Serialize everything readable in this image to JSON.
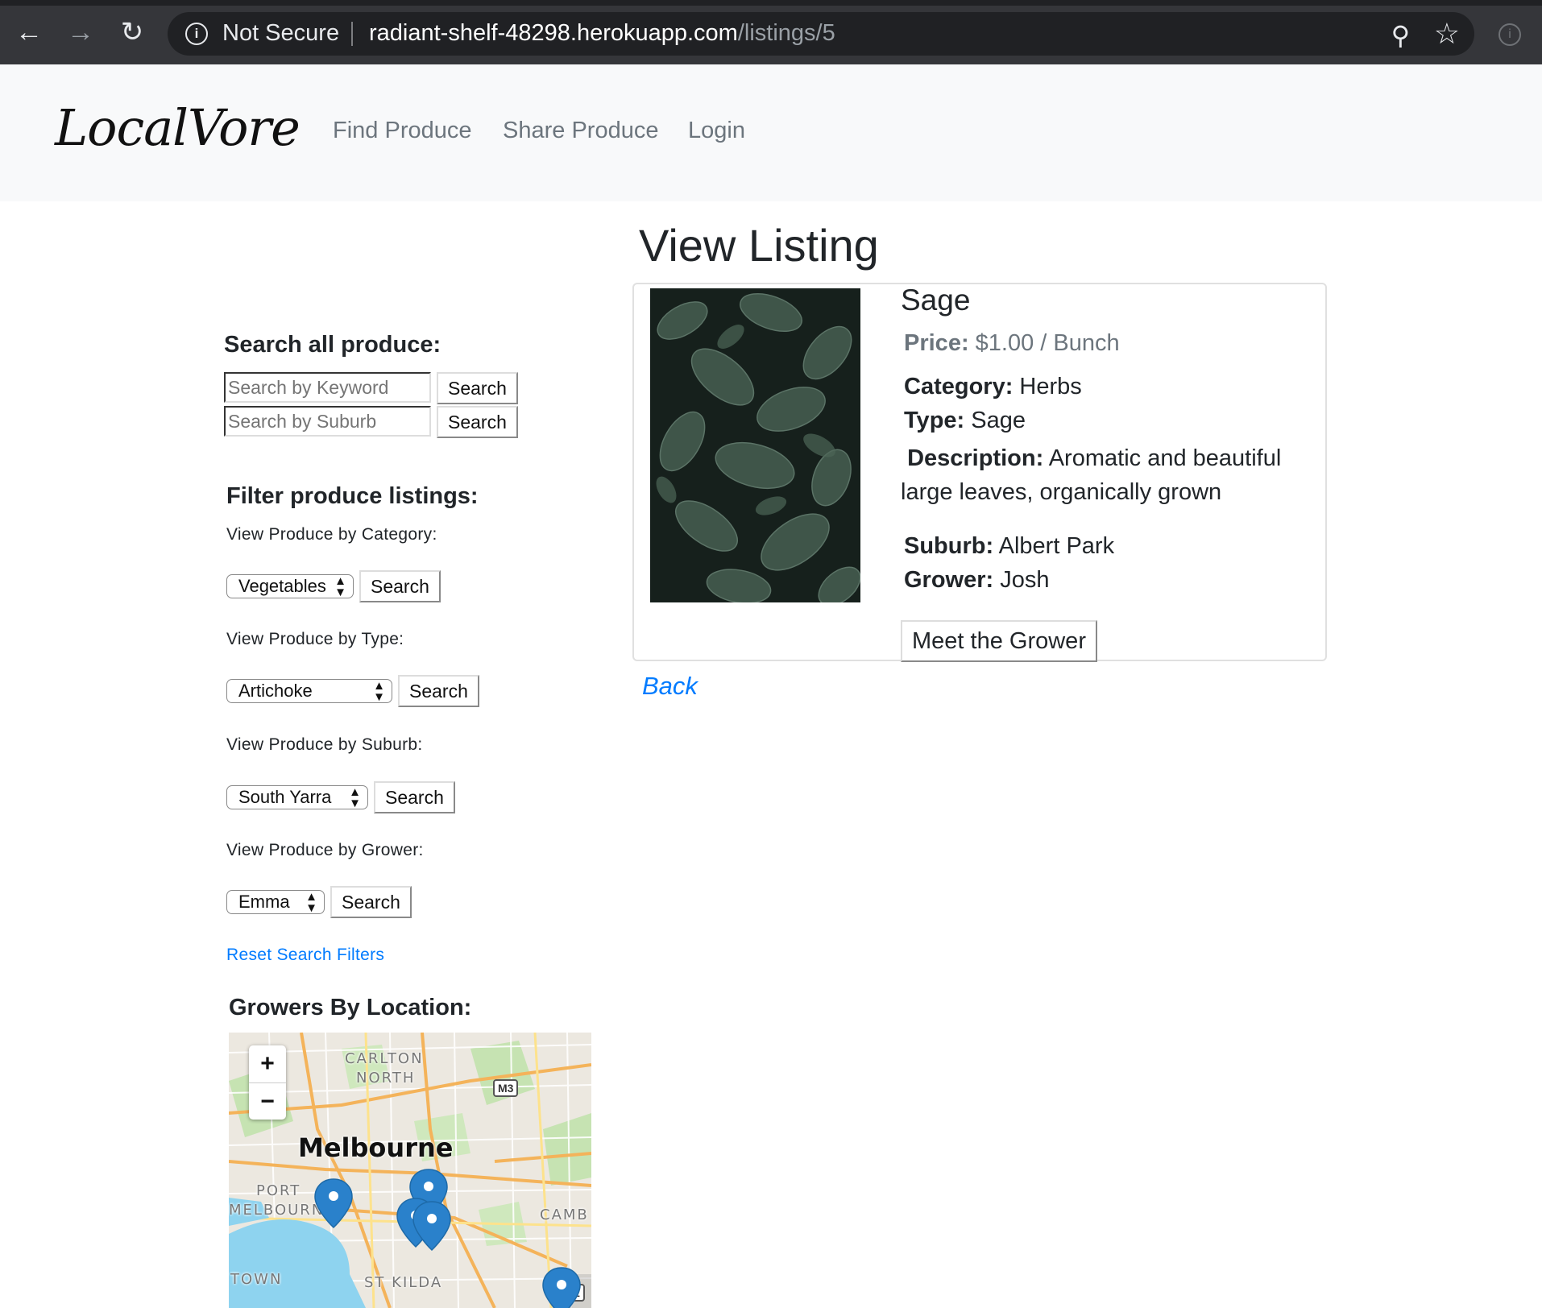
{
  "browser": {
    "security_label": "Not Secure",
    "url_host": "radiant-shelf-48298.herokuapp.com",
    "url_path": "/listings/5"
  },
  "navbar": {
    "brand": "LocalVore",
    "links": [
      "Find Produce",
      "Share Produce",
      "Login"
    ]
  },
  "sidebar": {
    "search_heading": "Search all produce:",
    "keyword_placeholder": "Search by Keyword",
    "suburb_placeholder": "Search by Suburb",
    "search_button": "Search",
    "filter_heading": "Filter produce listings:",
    "filters": [
      {
        "label": "View Produce by Category:",
        "selected": "Vegetables",
        "button": "Search"
      },
      {
        "label": "View Produce by Type:",
        "selected": "Artichoke",
        "button": "Search"
      },
      {
        "label": "View Produce by Suburb:",
        "selected": "South Yarra",
        "button": "Search"
      },
      {
        "label": "View Produce by Grower:",
        "selected": "Emma",
        "button": "Search"
      }
    ],
    "reset_link": "Reset Search Filters",
    "map_heading": "Growers By Location:"
  },
  "map": {
    "zoom_in": "+",
    "zoom_out": "−",
    "labels": {
      "carlton": "CARLTON",
      "north": "NORTH",
      "melbourne": "Melbourne",
      "port": "PORT",
      "melbourne_port": "MELBOURN",
      "st_kilda": "ST KILDA",
      "camb": "CAMB",
      "town": "TOWN",
      "route_m3": "M3",
      "route_1": "1"
    },
    "marker_count": 5
  },
  "listing": {
    "page_title": "View Listing",
    "title": "Sage",
    "price_label": "Price:",
    "price_value": "$1.00 / Bunch",
    "category_label": "Category:",
    "category_value": "Herbs",
    "type_label": "Type:",
    "type_value": "Sage",
    "description_label": "Description:",
    "description_value": "Aromatic and beautiful large leaves, organically grown",
    "suburb_label": "Suburb:",
    "suburb_value": "Albert Park",
    "grower_label": "Grower:",
    "grower_value": "Josh",
    "meet_button": "Meet the Grower",
    "back_link": "Back"
  }
}
